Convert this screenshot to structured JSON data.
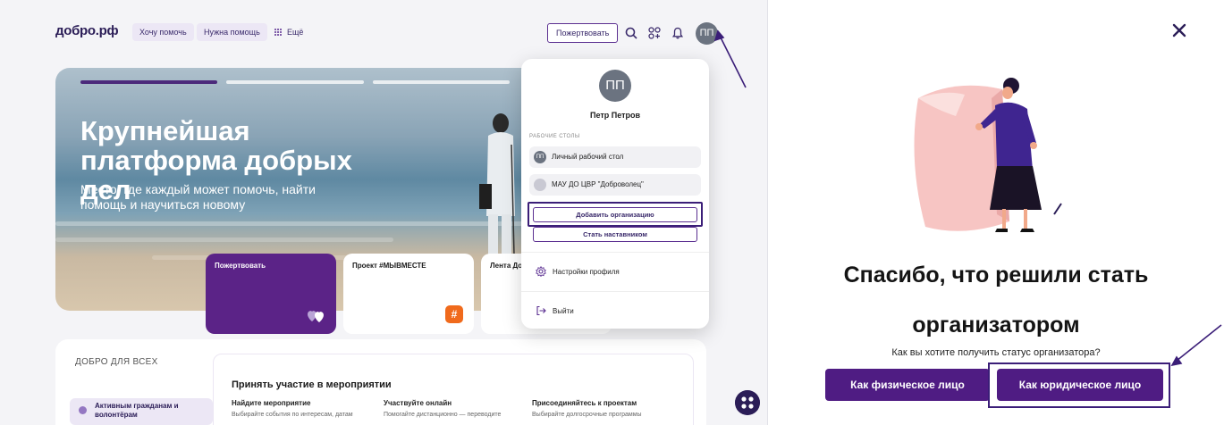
{
  "header": {
    "logo": "добро.рф",
    "nav": [
      {
        "label": "Хочу помочь"
      },
      {
        "label": "Нужна помощь"
      }
    ],
    "more_label": "Ещё",
    "donate_label": "Пожертвовать",
    "avatar_initials": "ПП",
    "icons": [
      "search-icon",
      "apps-icon",
      "bell-icon"
    ]
  },
  "hero": {
    "title": "Крупнейшая платформа добрых дел",
    "subtitle": "Место, где каждый может помочь, найти помощь и научиться новому",
    "cards": [
      {
        "label": "Пожертвовать"
      },
      {
        "label": "Проект #МЫВМЕСТЕ"
      },
      {
        "label": "Лента Добр"
      }
    ]
  },
  "lower": {
    "section_title": "ДОБРО ДЛЯ ВСЕХ",
    "inner_title": "Принять участие в мероприятии",
    "columns": [
      {
        "heading": "Найдите мероприятие",
        "text": "Выбирайте события по интересам, датам"
      },
      {
        "heading": "Участвуйте онлайн",
        "text": "Помогайте дистанционно — переводите"
      },
      {
        "heading": "Присоединяйтесь к проектам",
        "text": "Выбирайте долгосрочные программы"
      }
    ],
    "audience_label": "Активным гражданам и волонтёрам"
  },
  "dropdown": {
    "avatar_initials": "ПП",
    "name": "Петр Петров",
    "section_label": "РАБОЧИЕ СТОЛЫ",
    "workspaces": [
      {
        "initials": "ПП",
        "label": "Личный рабочий стол"
      },
      {
        "initials": "",
        "label": "МАУ ДО ЦВР \"Доброволец\""
      }
    ],
    "add_org_label": "Добавить организацию",
    "mentor_label": "Стать наставником",
    "settings_label": "Настройки профиля",
    "logout_label": "Выйти"
  },
  "modal": {
    "thanks_line1": "Спасибо, что решили стать",
    "thanks_line2": "организатором",
    "question": "Как вы хотите получить статус организатора?",
    "individual_label": "Как физическое лицо",
    "legal_label": "Как юридическое лицо"
  },
  "colors": {
    "brand": "#4f1c83",
    "brand_dark": "#2b1d57",
    "highlight": "#3b1e78",
    "pane_bg": "#f4f4f7"
  }
}
